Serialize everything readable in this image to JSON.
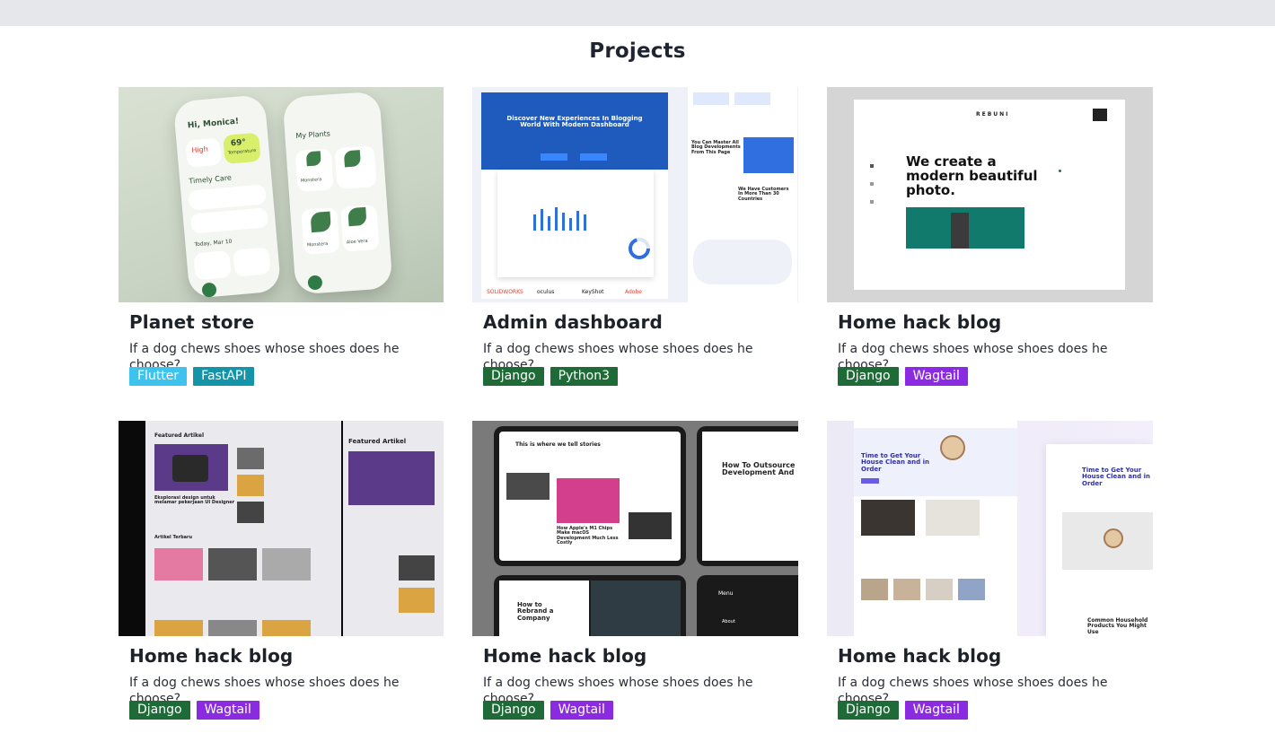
{
  "section": {
    "title": "Projects"
  },
  "projects": [
    {
      "title": "Planet store",
      "description": "If a dog chews shoes whose shoes does he choose?",
      "tags": [
        {
          "label": "Flutter",
          "color": "#3ec3ee"
        },
        {
          "label": "FastAPI",
          "color": "#1494a8"
        }
      ],
      "thumb_text": {
        "greeting": "Hi, Monica!",
        "high": "High",
        "temp": "69°",
        "temp_label": "Temperature",
        "timely": "Timely Care",
        "today": "Today, Mar 10",
        "my_plants": "My Plants",
        "monstera": "Monstera",
        "monstera2": "Monstera",
        "aloe": "Aloe Vera"
      }
    },
    {
      "title": "Admin dashboard",
      "description": "If a dog chews shoes whose shoes does he choose?",
      "tags": [
        {
          "label": "Django",
          "color": "#1f6b37"
        },
        {
          "label": "Python3",
          "color": "#1f6b37"
        }
      ],
      "thumb_text": {
        "headline": "Discover New Experiences In Blogging World With Modern Dashboard",
        "brands": [
          "SOLIDWORKS",
          "oculus",
          "KeyShot",
          "Adobe"
        ],
        "side1": "You Can Master All Blog Developments From This Page",
        "side2": "We Have Customers In More Than 30 Countries"
      }
    },
    {
      "title": "Home hack blog",
      "description": "If a dog chews shoes whose shoes does he choose?",
      "tags": [
        {
          "label": "Django",
          "color": "#1f6b37"
        },
        {
          "label": "Wagtail",
          "color": "#8a2be2"
        }
      ],
      "thumb_text": {
        "brand": "REBUNI",
        "headline": "We create a modern beautiful photo."
      }
    },
    {
      "title": "Home hack blog",
      "description": "If a dog chews shoes whose shoes does he choose?",
      "tags": [
        {
          "label": "Django",
          "color": "#1f6b37"
        },
        {
          "label": "Wagtail",
          "color": "#8a2be2"
        }
      ],
      "thumb_text": {
        "featured": "Featured Artikel",
        "featured2": "Featured Artikel",
        "terbaru": "Artikel Terbaru",
        "caption": "Eksplorasi design untuk melamar pekerjaan UI Designer"
      }
    },
    {
      "title": "Home hack blog",
      "description": "If a dog chews shoes whose shoes does he choose?",
      "tags": [
        {
          "label": "Django",
          "color": "#1f6b37"
        },
        {
          "label": "Wagtail",
          "color": "#8a2be2"
        }
      ],
      "thumb_text": {
        "header": "This is where we tell stories",
        "apple": "How Apple's M1 Chips Make macOS Development Much Less Costly",
        "outsource": "How To Outsource Development And",
        "rebrand": "How to Rebrand a Company",
        "menu": "Menu",
        "about": "About"
      }
    },
    {
      "title": "Home hack blog",
      "description": "If a dog chews shoes whose shoes does he choose?",
      "tags": [
        {
          "label": "Django",
          "color": "#1f6b37"
        },
        {
          "label": "Wagtail",
          "color": "#8a2be2"
        }
      ],
      "thumb_text": {
        "hero": "Time to Get Your House Clean and in Order",
        "hero2": "Time to Get Your House Clean and in Order",
        "products": "Common Household Products You Might Use"
      }
    }
  ]
}
